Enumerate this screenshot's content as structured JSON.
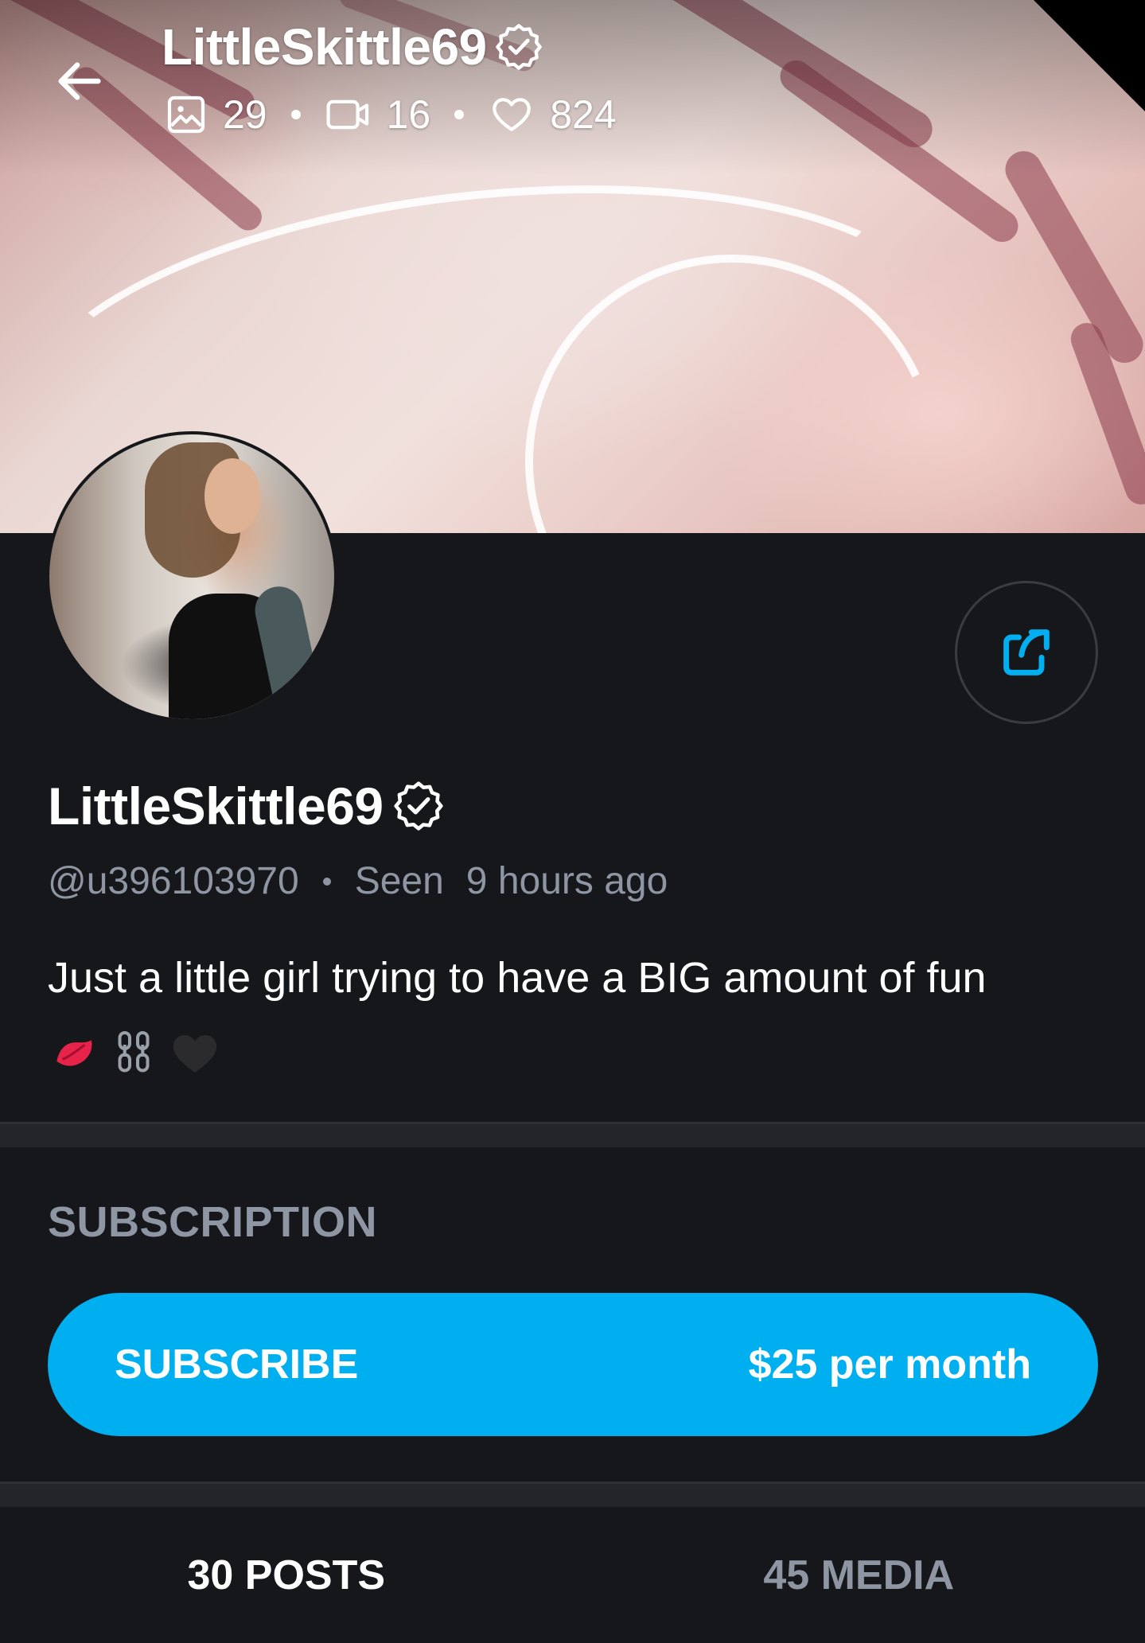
{
  "header": {
    "username": "LittleSkittle69",
    "stats": {
      "photos": "29",
      "videos": "16",
      "likes": "824"
    }
  },
  "profile": {
    "display_name": "LittleSkittle69",
    "handle": "@u396103970",
    "seen_label": "Seen",
    "seen_time": "9 hours ago",
    "bio": "Just a little girl trying to have a BIG amount of fun"
  },
  "subscription": {
    "section_title": "SUBSCRIPTION",
    "button_label": "SUBSCRIBE",
    "price": "$25 per month"
  },
  "tabs": [
    {
      "label": "30 POSTS",
      "active": true
    },
    {
      "label": "45 MEDIA",
      "active": false
    }
  ],
  "colors": {
    "accent": "#00aff0",
    "background": "#16171b",
    "muted_text": "#8f96a3"
  },
  "icons": [
    "back-arrow-icon",
    "verified-badge-icon",
    "image-icon",
    "video-icon",
    "heart-icon",
    "share-icon",
    "kiss-emoji-icon",
    "chain-emoji-icon",
    "black-heart-emoji-icon"
  ]
}
